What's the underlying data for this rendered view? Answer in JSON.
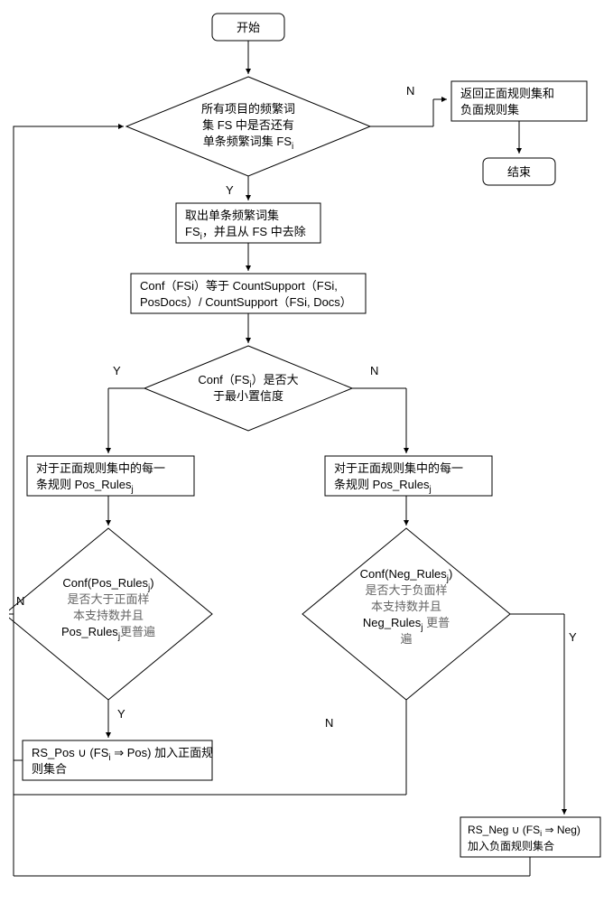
{
  "nodes": {
    "start": "开始",
    "d1_l1": "所有项目的频繁词",
    "d1_l2": "集 FS 中是否还有",
    "d1_l3": "单条频繁词集 FS",
    "d1_sub": "i",
    "ret_l1": "返回正面规则集和",
    "ret_l2": "负面规则集",
    "end": "结束",
    "p1_l1": "取出单条频繁词集",
    "p1_l2a": "FS",
    "p1_l2b": "，并且从 FS 中去除",
    "p2_l1": "Conf（FSi）等于 CountSupport（FSi,",
    "p2_l2": "PosDocs）/ CountSupport（FSi, Docs）",
    "d2_l1": "Conf（FS",
    "d2_l1b": "）是否大",
    "d2_l2": "于最小置信度",
    "p3_l1": "对于正面规则集中的每一",
    "p3_l2a": "条规则 Pos_Rules",
    "p3_l2sub": "j",
    "p4_l1": "对于正面规则集中的每一",
    "p4_l2a": "条规则 Pos_Rules",
    "p4_l2sub": "j",
    "d3_l1a": "Conf(Pos_Rules",
    "d3_l1b": ")",
    "d3_l2": "是否大于正面样",
    "d3_l3": "本支持数并且",
    "d3_l4a": "Pos_Rules",
    "d3_l4b": "更普遍",
    "d4_l1a": "Conf(Neg_Rules",
    "d4_l1b": ")",
    "d4_l2": "是否大于负面样",
    "d4_l3": "本支持数并且",
    "d4_l4a": "Neg_Rules",
    "d4_l4b": " 更普",
    "d4_l5": "遍",
    "p5_l1a": "RS_Pos ∪ (FS",
    "p5_l1b": " ⇒ Pos) 加入正面规",
    "p5_l2": "则集合",
    "p6_l1a": "RS_Neg ∪ (FS",
    "p6_l1b": " ⇒ Neg)",
    "p6_l2": "加入负面规则集合"
  },
  "labels": {
    "Y": "Y",
    "N": "N"
  }
}
